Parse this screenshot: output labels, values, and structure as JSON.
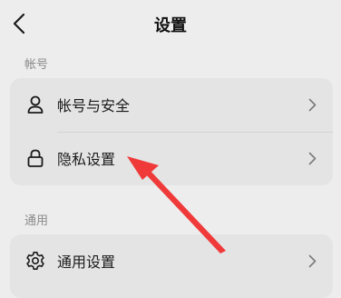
{
  "header": {
    "title": "设置",
    "back_icon": "chevron-left-icon"
  },
  "sections": [
    {
      "label": "帐号",
      "items": [
        {
          "label": "帐号与安全",
          "icon": "user-icon"
        },
        {
          "label": "隐私设置",
          "icon": "lock-icon"
        }
      ]
    },
    {
      "label": "通用",
      "items": [
        {
          "label": "通用设置",
          "icon": "gear-icon"
        }
      ]
    }
  ],
  "colors": {
    "background": "#ededed",
    "card": "#e4e4e4",
    "annotation_arrow": "#f03a3a",
    "section_label": "#8a8a8a"
  }
}
